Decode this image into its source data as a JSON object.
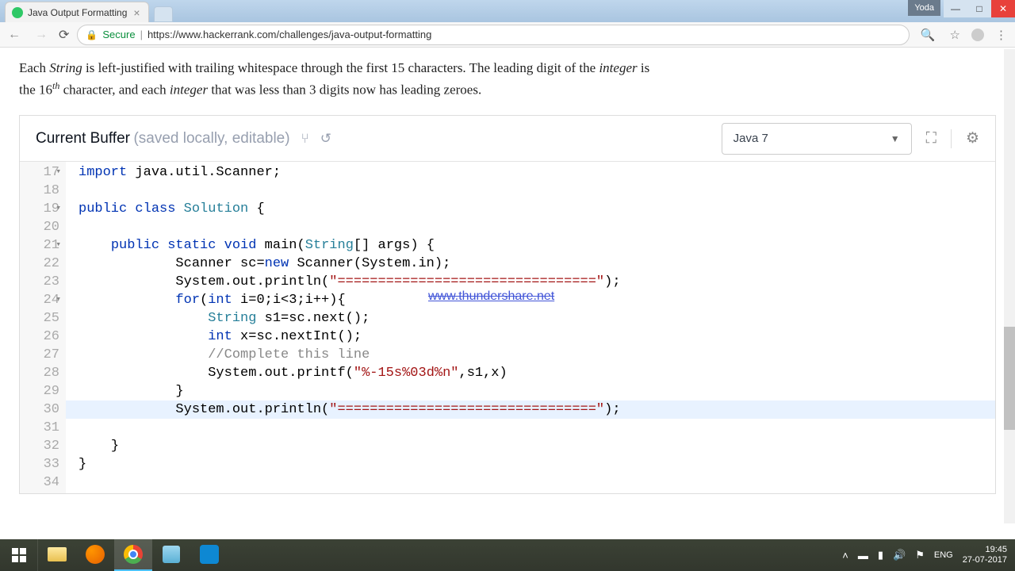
{
  "window": {
    "user_badge": "Yoda",
    "tab_title": "Java Output Formatting"
  },
  "address_bar": {
    "secure_label": "Secure",
    "url": "https://www.hackerrank.com/challenges/java-output-formatting"
  },
  "problem": {
    "text_prefix": "Each ",
    "string_word": "String",
    "text_mid1": " is left-justified with trailing whitespace through the first ",
    "fifteen": "15",
    "text_mid2": " characters. The leading digit of the ",
    "integer1": "integer",
    "text_mid3": " is the ",
    "sixteen": "16",
    "th": "th",
    "text_mid4": " character, and each ",
    "integer2": "integer",
    "text_mid5": " that was less than ",
    "three": "3",
    "text_end": " digits now has leading zeroes."
  },
  "editor_header": {
    "title": "Current Buffer",
    "subtitle": "(saved locally, editable)",
    "language": "Java 7"
  },
  "gutter": {
    "start": 17,
    "end": 34,
    "fold_lines": [
      17,
      19,
      21,
      24
    ]
  },
  "code": {
    "l17": {
      "kw1": "import",
      "rest": " java.util.Scanner;"
    },
    "l18": "",
    "l19": {
      "kw1": "public",
      "kw2": "class",
      "cls": "Solution",
      "rest": " {"
    },
    "l20": "",
    "l21": {
      "indent": "    ",
      "kw1": "public",
      "kw2": "static",
      "kw3": "void",
      "fn": "main",
      "p1": "(",
      "typ": "String",
      "p2": "[] args) {"
    },
    "l22": {
      "indent": "            ",
      "txt1": "Scanner sc=",
      "kw": "new",
      "txt2": " Scanner(System.in);"
    },
    "l23": {
      "indent": "            ",
      "txt1": "System.out.println(",
      "str": "\"================================\"",
      "txt2": ");"
    },
    "l24": {
      "indent": "            ",
      "kw1": "for",
      "p1": "(",
      "kw2": "int",
      "txt": " i=0;i<3;i++){"
    },
    "l25": {
      "indent": "                ",
      "typ": "String",
      "txt": " s1=sc.next();"
    },
    "l26": {
      "indent": "                ",
      "kw": "int",
      "txt": " x=sc.nextInt();"
    },
    "l27": {
      "indent": "                ",
      "com": "//Complete this line"
    },
    "l28": {
      "indent": "                ",
      "txt1": "System.out.printf(",
      "str": "\"%-15s%03d%n\"",
      "txt2": ",s1,x)"
    },
    "l29": {
      "indent": "            ",
      "txt": "}"
    },
    "l30": {
      "indent": "            ",
      "txt1": "System.out.println(",
      "str": "\"================================\"",
      "txt2": ");"
    },
    "l31": "",
    "l32": {
      "indent": "    ",
      "txt": "}"
    },
    "l33": {
      "txt": "}"
    },
    "l34": ""
  },
  "watermark": "www.thundershare.net",
  "taskbar": {
    "lang": "ENG",
    "time": "19:45",
    "date": "27-07-2017"
  }
}
